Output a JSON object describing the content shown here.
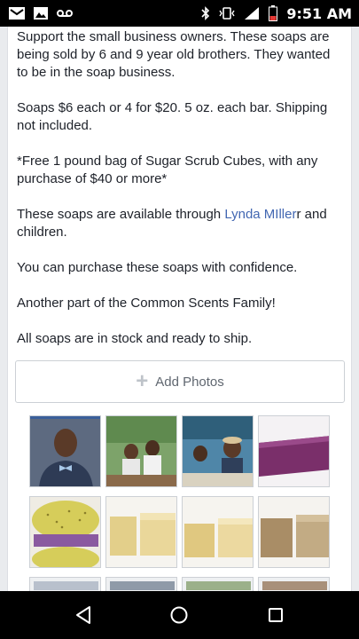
{
  "status_bar": {
    "time": "9:51 AM",
    "icons": [
      "gmail-icon",
      "gallery-icon",
      "voicemail-icon",
      "bluetooth-icon",
      "vibrate-icon",
      "signal-icon",
      "battery-icon"
    ]
  },
  "post": {
    "paragraph_1": "Support the small business owners. These soaps are being sold by 6 and 9 year old brothers. They wanted to be in the soap business.",
    "paragraph_2": "Soaps $6 each or 4 for $20. 5 oz. each bar. Shipping not included.",
    "paragraph_3": "*Free 1 pound bag of Sugar Scrub Cubes, with any purchase of $40 or more*",
    "paragraph_4_prefix": "These soaps are available through ",
    "paragraph_4_link": "Lynda MIller",
    "paragraph_4_suffix": "r and children.",
    "paragraph_5": "You can purchase these soaps with confidence.",
    "paragraph_6": "Another part of the Common Scents Family!",
    "paragraph_7": "All soaps are in stock and ready to ship."
  },
  "add_photos": {
    "label": "Add Photos",
    "icon": "plus-icon"
  },
  "photos": [
    {
      "name": "photo-boy-bowtie",
      "color": "#3a4660"
    },
    {
      "name": "photo-kids-outdoors",
      "color": "#5a7a4a"
    },
    {
      "name": "photo-kids-booth",
      "color": "#3f6f8a"
    },
    {
      "name": "photo-purple-soap",
      "color": "#7a2f6a"
    },
    {
      "name": "photo-sponge-soap",
      "color": "#c9c15a"
    },
    {
      "name": "photo-yellow-soap-1",
      "color": "#e3cf8a"
    },
    {
      "name": "photo-yellow-soap-2",
      "color": "#e8d59a"
    },
    {
      "name": "photo-brown-soap",
      "color": "#b7a07a"
    }
  ],
  "nav_bar": {
    "icons": [
      "back-icon",
      "home-icon",
      "recents-icon"
    ]
  }
}
